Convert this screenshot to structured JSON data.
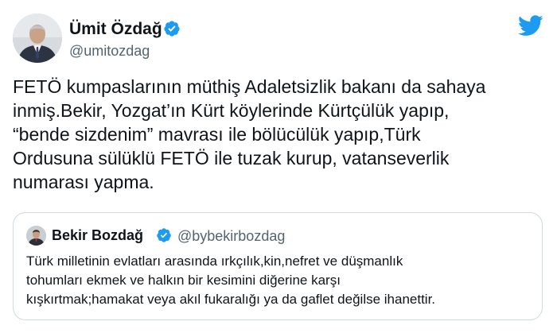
{
  "colors": {
    "brand_blue": "#1d9bf0",
    "text": "#0f1419",
    "secondary_text": "#536471",
    "border": "#cfd9de"
  },
  "author": {
    "display_name": "Ümit Özdağ",
    "handle": "@umitozdag",
    "verified_icon": "verified-badge-icon"
  },
  "header": {
    "logo_icon": "twitter-bird-icon"
  },
  "tweet": {
    "text_lines": [
      "FETÖ kumpaslarının müthiş Adaletsizlik bakanı da sahaya",
      "inmiş.Bekir, Yozgat’ın Kürt köylerinde Kürtçülük yapıp,",
      "“bende sizdenim” mavrası ile bölücülük yapıp,Türk",
      "Ordusuna sülüklü FETÖ ile tuzak kurup, vatanseverlik",
      "numarası yapma."
    ]
  },
  "quoted_tweet": {
    "display_name": "Bekir Bozdağ",
    "handle": "@bybekirbozdag",
    "verified_icon": "verified-badge-icon",
    "text_lines": [
      "Türk milletinin evlatları arasında ırkçılık,kin,nefret ve düşmanlık",
      "tohumları ekmek ve halkın bir kesimini diğerine karşı",
      "kışkırtmak;hamakat veya akıl fukaralığı ya da gaflet değilse ihanettir."
    ]
  }
}
